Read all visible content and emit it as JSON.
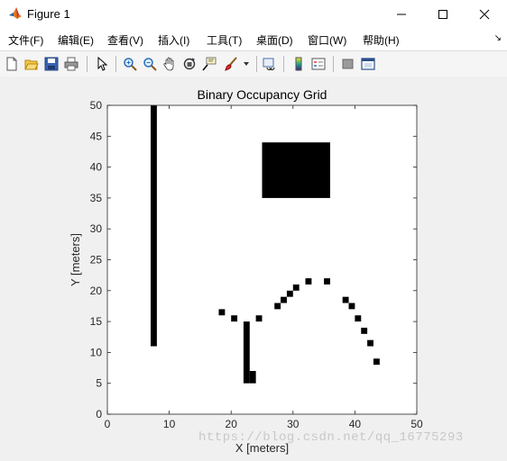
{
  "window": {
    "title": "Figure 1",
    "controls": [
      "minimize-icon",
      "maximize-icon",
      "close-icon"
    ]
  },
  "menu": {
    "items": [
      {
        "label": "文件(F)"
      },
      {
        "label": "编辑(E)"
      },
      {
        "label": "查看(V)"
      },
      {
        "label": "插入(I)"
      },
      {
        "label": "工具(T)"
      },
      {
        "label": "桌面(D)"
      },
      {
        "label": "窗口(W)"
      },
      {
        "label": "帮助(H)"
      }
    ]
  },
  "toolbar": {
    "icons": [
      "new-figure-icon",
      "open-file-icon",
      "save-icon",
      "print-icon",
      "pointer-icon",
      "zoom-in-icon",
      "zoom-out-icon",
      "pan-icon",
      "rotate-3d-icon",
      "data-cursor-icon",
      "brush-icon",
      "link-plot-icon",
      "insert-colorbar-icon",
      "insert-legend-icon",
      "hide-plot-tools-icon",
      "show-plot-tools-icon"
    ]
  },
  "colors": {
    "occupied": "#000000",
    "free": "#ffffff",
    "axes_text": "#262626",
    "window_bg": "#f0f0f0"
  },
  "chart_data": {
    "type": "heatmap",
    "title": "Binary Occupancy Grid",
    "xlabel": "X [meters]",
    "ylabel": "Y [meters]",
    "xlim": [
      0,
      50
    ],
    "ylim": [
      0,
      50
    ],
    "xticks": [
      0,
      10,
      20,
      30,
      40,
      50
    ],
    "yticks": [
      0,
      5,
      10,
      15,
      20,
      25,
      30,
      35,
      40,
      45,
      50
    ],
    "grid": false,
    "occupied_regions": [
      {
        "name": "wall",
        "x": [
          7,
          8
        ],
        "y": [
          11,
          50
        ]
      },
      {
        "name": "block",
        "x": [
          25,
          36
        ],
        "y": [
          35,
          44
        ]
      },
      {
        "name": "post",
        "x": [
          22,
          23
        ],
        "y": [
          5,
          15
        ]
      },
      {
        "name": "post-foot",
        "x": [
          23,
          24
        ],
        "y": [
          5,
          7
        ]
      },
      {
        "name": "cell",
        "x": [
          18,
          19
        ],
        "y": [
          16,
          17
        ]
      },
      {
        "name": "cell",
        "x": [
          20,
          21
        ],
        "y": [
          15,
          16
        ]
      },
      {
        "name": "cell",
        "x": [
          24,
          25
        ],
        "y": [
          15,
          16
        ]
      },
      {
        "name": "cell",
        "x": [
          27,
          28
        ],
        "y": [
          17,
          18
        ]
      },
      {
        "name": "cell",
        "x": [
          28,
          29
        ],
        "y": [
          18,
          19
        ]
      },
      {
        "name": "cell",
        "x": [
          29,
          30
        ],
        "y": [
          19,
          20
        ]
      },
      {
        "name": "cell",
        "x": [
          30,
          31
        ],
        "y": [
          20,
          21
        ]
      },
      {
        "name": "cell",
        "x": [
          32,
          33
        ],
        "y": [
          21,
          22
        ]
      },
      {
        "name": "cell",
        "x": [
          35,
          36
        ],
        "y": [
          21,
          22
        ]
      },
      {
        "name": "cell",
        "x": [
          38,
          39
        ],
        "y": [
          18,
          19
        ]
      },
      {
        "name": "cell",
        "x": [
          39,
          40
        ],
        "y": [
          17,
          18
        ]
      },
      {
        "name": "cell",
        "x": [
          40,
          41
        ],
        "y": [
          15,
          16
        ]
      },
      {
        "name": "cell",
        "x": [
          41,
          42
        ],
        "y": [
          13,
          14
        ]
      },
      {
        "name": "cell",
        "x": [
          42,
          43
        ],
        "y": [
          11,
          12
        ]
      },
      {
        "name": "cell",
        "x": [
          43,
          44
        ],
        "y": [
          8,
          9
        ]
      }
    ]
  },
  "watermark": "https://blog.csdn.net/qq_16775293"
}
